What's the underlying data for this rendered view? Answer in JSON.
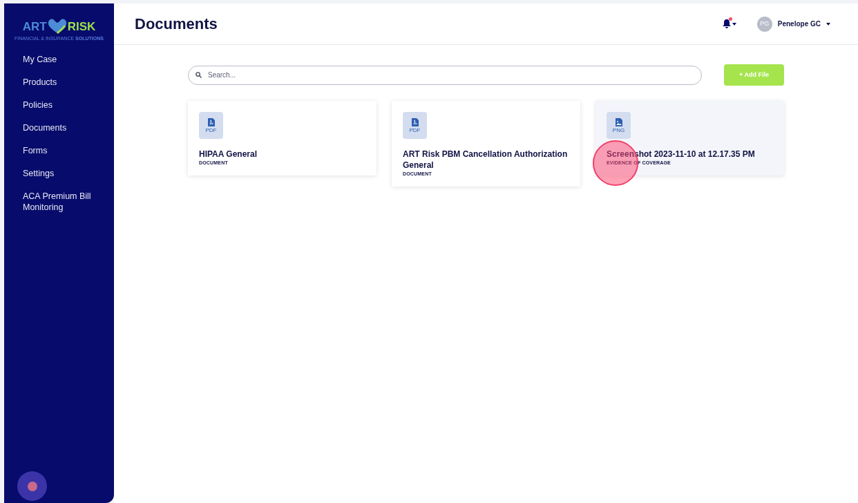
{
  "logo": {
    "left": "ART",
    "right": "RISK",
    "tagline": "FINANCIAL & INSURANCE **SOLUTIONS**"
  },
  "sidebar": {
    "items": [
      {
        "label": "My Case",
        "selected": false
      },
      {
        "label": "Products",
        "selected": false
      },
      {
        "label": "Policies",
        "selected": false
      },
      {
        "label": "Documents",
        "selected": false
      },
      {
        "label": "Forms",
        "selected": false
      },
      {
        "label": "Settings",
        "selected": false
      },
      {
        "label": "ACA Premium Bill Monitoring",
        "selected": false
      }
    ]
  },
  "header": {
    "title": "Documents",
    "notifications": {
      "unread": true
    },
    "user": {
      "initials": "PG",
      "name": "Penelope GC"
    }
  },
  "search": {
    "placeholder": "Search..."
  },
  "add_button": "+ Add File",
  "documents": [
    {
      "file_type": "PDF",
      "kind": "pdf",
      "name": "HIPAA General",
      "category": "DOCUMENT",
      "hovered": false
    },
    {
      "file_type": "PDF",
      "kind": "pdf",
      "name": "ART Risk PBM Cancellation Authorization General",
      "category": "DOCUMENT",
      "hovered": false
    },
    {
      "file_type": "PNG",
      "kind": "image",
      "name": "Screenshot 2023-11-10 at 12.17.35 PM",
      "category": "EVIDENCE OF COVERAGE",
      "hovered": true
    }
  ],
  "click_marker": {
    "shown": true
  }
}
